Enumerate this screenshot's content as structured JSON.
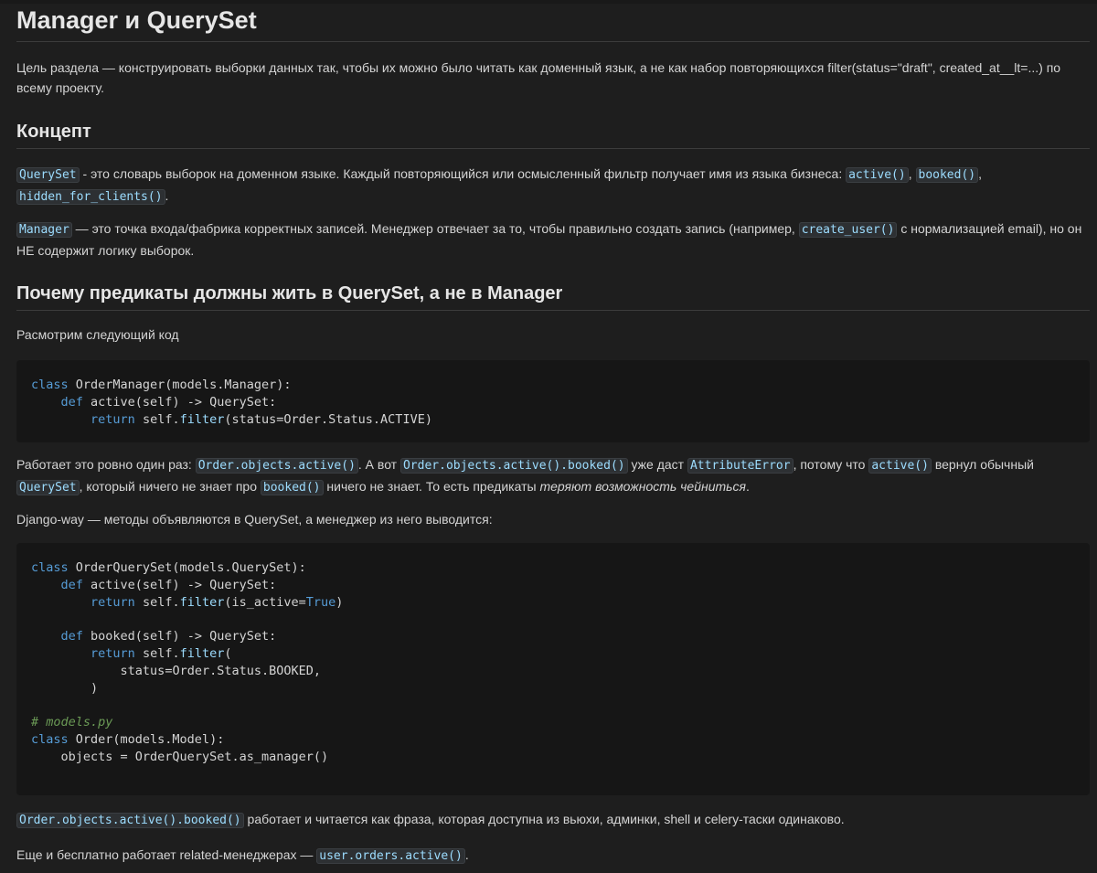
{
  "title": "Manager и QuerySet",
  "intro": "Цель раздела — конструировать выборки данных так, чтобы их можно было читать как доменный язык, а не как набор повторяющихся filter(status=\"draft\", created_at__lt=...) по всему проекту.",
  "concept": {
    "heading": "Концепт",
    "qs_code": "QuerySet",
    "qs_text": " - это словарь выборок на доменном языке. Каждый повторяющийся или осмысленный фильтр получает имя из языка бизнеса: ",
    "qs_active": "active()",
    "qs_comma1": ", ",
    "qs_booked": "booked()",
    "qs_comma2": ", ",
    "qs_hidden": "hidden_for_clients()",
    "qs_end": ".",
    "mgr_code": "Manager",
    "mgr_text": " — это точка входа/фабрика корректных записей. Менеджер отвечает за то, чтобы правильно создать запись (например, ",
    "mgr_create": "create_user()",
    "mgr_text2": " с нормализацией email), но он НЕ содержит логику выборок."
  },
  "why": {
    "heading": "Почему предикаты должны жить в QuerySet, а не в Manager",
    "consider": "Расмотрим следующий код",
    "code1": {
      "l1_kw": "class",
      "l1_rest": " OrderManager(models.Manager):",
      "l2_kw": "def",
      "l2_rest": " active(self) -> QuerySet:",
      "l3_kw": "return",
      "l3_self": " self.",
      "l3_fn": "filter",
      "l3_rest": "(status=Order.Status.ACTIVE)"
    },
    "works_t1": "Работает это ровно один раз: ",
    "works_c1": "Order.objects.active()",
    "works_t2": ". А вот ",
    "works_c2": "Order.objects.active().booked()",
    "works_t3": " уже даст ",
    "works_c3": "AttributeError",
    "works_t4": ", потому что ",
    "works_c4": "active()",
    "works_t5": " вернул обычный ",
    "works_c5": "QuerySet",
    "works_t6": ", который ничего не знает про ",
    "works_c6": "booked()",
    "works_t7": " ничего не знает. То есть предикаты ",
    "works_em": "теряют возможность чейниться",
    "works_t8": ".",
    "django": "Django-way — методы объявляются в QuerySet, а менеджер из него выводится:",
    "code2": {
      "l1_kw": "class",
      "l1_rest": " OrderQuerySet(models.QuerySet):",
      "l2_kw": "def",
      "l2_rest": " active(self) -> QuerySet:",
      "l3_kw": "return",
      "l3_self": " self.",
      "l3_fn": "filter",
      "l3_rest": "(is_active=",
      "l3_const": "True",
      "l3_end": ")",
      "l5_kw": "def",
      "l5_rest": " booked(self) -> QuerySet:",
      "l6_kw": "return",
      "l6_self": " self.",
      "l6_fn": "filter",
      "l6_rest": "(",
      "l7": "status=Order.Status.BOOKED,",
      "l8": ")",
      "l10_cm": "# models.py",
      "l11_kw": "class",
      "l11_rest": " Order(models.Model):",
      "l12": "objects = OrderQuerySet.as_manager()"
    },
    "phrase_code": "Order.objects.active().booked()",
    "phrase_text": " работает и читается как фраза, которая доступна из вьюхи, админки, shell и celery-таски одинаково.",
    "related_text": "Еще и бесплатно работает related-менеджерах — ",
    "related_code": "user.orders.active()",
    "related_end": "."
  }
}
